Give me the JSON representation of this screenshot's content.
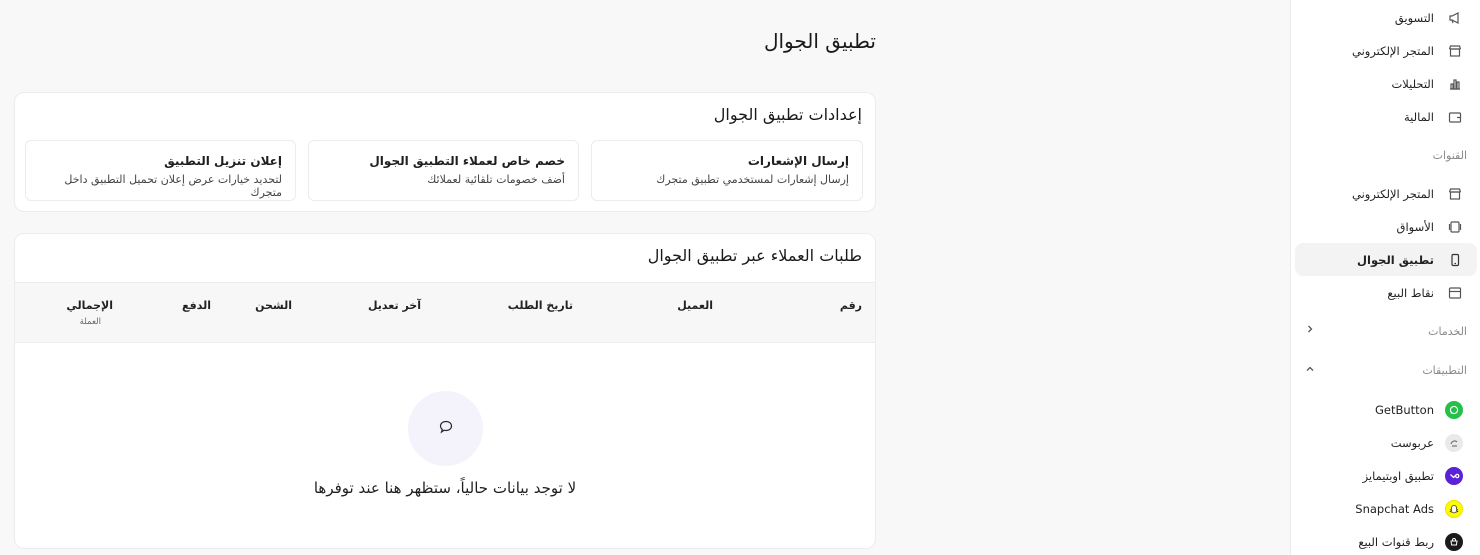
{
  "page": {
    "title": "تطبيق الجوال"
  },
  "sidebar": {
    "top_items": [
      {
        "label": "التسويق",
        "icon": "megaphone-icon"
      },
      {
        "label": "المتجر الإلكتروني",
        "icon": "store-icon"
      },
      {
        "label": "التحليلات",
        "icon": "bar-chart-icon"
      },
      {
        "label": "المالية",
        "icon": "wallet-icon"
      }
    ],
    "channels_label": "القنوات",
    "channels": [
      {
        "label": "المتجر الإلكتروني",
        "icon": "store-icon"
      },
      {
        "label": "الأسواق",
        "icon": "marketplace-icon"
      },
      {
        "label": "تطبيق الجوال",
        "icon": "mobile-icon",
        "active": true
      },
      {
        "label": "نقاط البيع",
        "icon": "pos-icon"
      }
    ],
    "services_label": "الخدمات",
    "apps_label": "التطبيقات",
    "apps": [
      {
        "label": "GetButton",
        "icon": "whatsapp-icon",
        "color": "#25c04a"
      },
      {
        "label": "عربوست",
        "icon": "arabpost-icon",
        "color": "#e9e9e9"
      },
      {
        "label": "تطبيق اوبتيمايز",
        "icon": "optimize-icon",
        "color": "#5b21d6"
      },
      {
        "label": "Snapchat Ads",
        "icon": "snapchat-icon",
        "color": "#fffc00"
      },
      {
        "label": "ربط قنوات البيع",
        "icon": "sales-channels-icon",
        "color": "#1a1a1a"
      }
    ]
  },
  "settings_card": {
    "title": "إعدادات تطبيق الجوال",
    "options": [
      {
        "title": "إرسال الإشعارات",
        "desc": "إرسال إشعارات لمستخدمي تطبيق متجرك"
      },
      {
        "title": "خصم خاص لعملاء التطبيق الجوال",
        "desc": "أضف خصومات تلقائية لعملائك"
      },
      {
        "title": "إعلان تنزيل التطبيق",
        "desc": "لتحديد خيارات عرض إعلان تحميل التطبيق داخل متجرك"
      }
    ]
  },
  "orders_card": {
    "title": "طلبات العملاء عبر تطبيق الجوال",
    "columns": {
      "number": "رقم",
      "customer": "العميل",
      "order_date": "تاريخ الطلب",
      "last_modified": "آخر تعديل",
      "shipping": "الشحن",
      "payment": "الدفع",
      "total": "الإجمالي",
      "currency": "العملة"
    },
    "empty_message": "لا توجد بيانات حالياً، ستظهر هنا عند توفرها"
  },
  "colors": {
    "accent": "#5b21d6",
    "empty_circle": "#f4f2fb"
  }
}
